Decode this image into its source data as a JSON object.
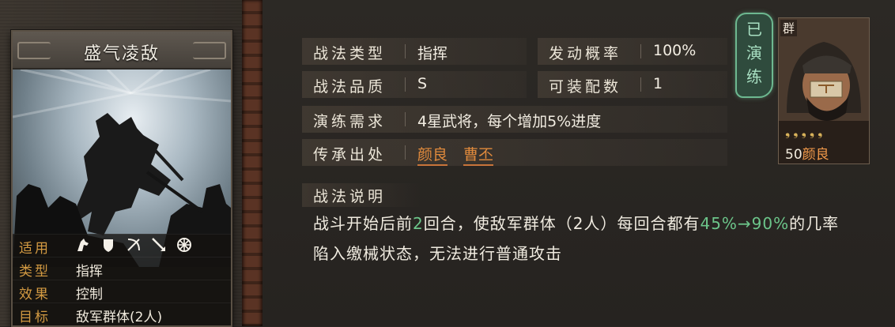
{
  "tactic_card": {
    "name": "盛气凌敌",
    "stats": [
      {
        "label": "适用",
        "value": "",
        "terrain_icons": [
          "cavalry-icon",
          "shield-icon",
          "bow-icon",
          "spear-icon",
          "siege-icon"
        ]
      },
      {
        "label": "类型",
        "value": "指挥"
      },
      {
        "label": "效果",
        "value": "控制"
      },
      {
        "label": "目标",
        "value": "敌军群体(2人)"
      }
    ]
  },
  "details": {
    "type": {
      "label": "战法类型",
      "value": "指挥"
    },
    "trigger_rate": {
      "label": "发动概率",
      "value": "100%"
    },
    "quality": {
      "label": "战法品质",
      "value": "S"
    },
    "equip_count": {
      "label": "可装配数",
      "value": "1"
    },
    "practice_req": {
      "label": "演练需求",
      "value": "4星武将，每个增加5%进度"
    },
    "source": {
      "label": "传承出处",
      "links": [
        "颜良",
        "曹丕"
      ]
    }
  },
  "description": {
    "heading": "战法说明",
    "parts": [
      {
        "text": "战斗开始后前",
        "highlight": false
      },
      {
        "text": "2",
        "highlight": true
      },
      {
        "text": "回合，使敌军群体（2人）每回合都有",
        "highlight": false
      },
      {
        "text": "45%→90%",
        "highlight": true
      },
      {
        "text": "的几率陷入缴械状态，无法进行普通攻击",
        "highlight": false
      }
    ]
  },
  "practiced_stamp": "已演练",
  "general": {
    "faction": "群",
    "level": "50",
    "name": "颜良",
    "stars": 5
  },
  "colors": {
    "label_orange": "#d39a42",
    "link_orange": "#e08a3c",
    "highlight_green": "#6cc58a",
    "stamp_green": "#6db890"
  }
}
